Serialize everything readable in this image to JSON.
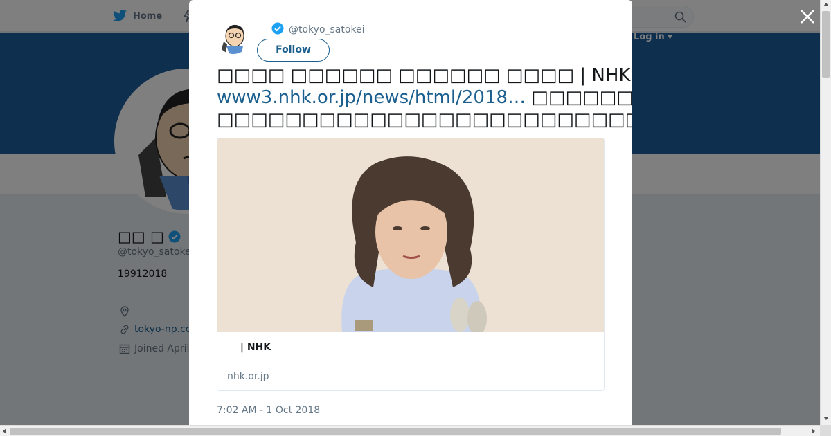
{
  "nav": {
    "home_label": "Home",
    "search_placeholder": "",
    "login_label": "Log in"
  },
  "profile": {
    "name": "□□ □",
    "handle": "@tokyo_satokei",
    "bio": "19912018",
    "url": "tokyo-np.co",
    "joined": "Joined April"
  },
  "tweet": {
    "handle": "@tokyo_satokei",
    "follow_label": "Follow",
    "line1": "□□□□ □□□□□□ □□□□□□ □□□□ | NHK□□□□",
    "link": "www3.nhk.or.jp/news/html/2018…",
    "line2_rest": "  □□□□□□□□□□",
    "line3": "□□□□□□□□□□□□□□□□□□□□□□□□□□□□□□□□□□□□□□□□□□□□□□□□□□□□□□□□□□",
    "card": {
      "title": "　 | NHK",
      "domain": "nhk.or.jp"
    },
    "timestamp": "7:02 AM - 1 Oct 2018"
  },
  "colors": {
    "twitter_blue": "#1da1f2",
    "link": "#1b5f8f",
    "banner": "#1f5f9c",
    "verified": "#1da1f2"
  },
  "icons": {
    "close": "close-icon",
    "twitter": "twitter-bird-icon",
    "search": "search-icon",
    "verified": "verified-badge-icon"
  }
}
